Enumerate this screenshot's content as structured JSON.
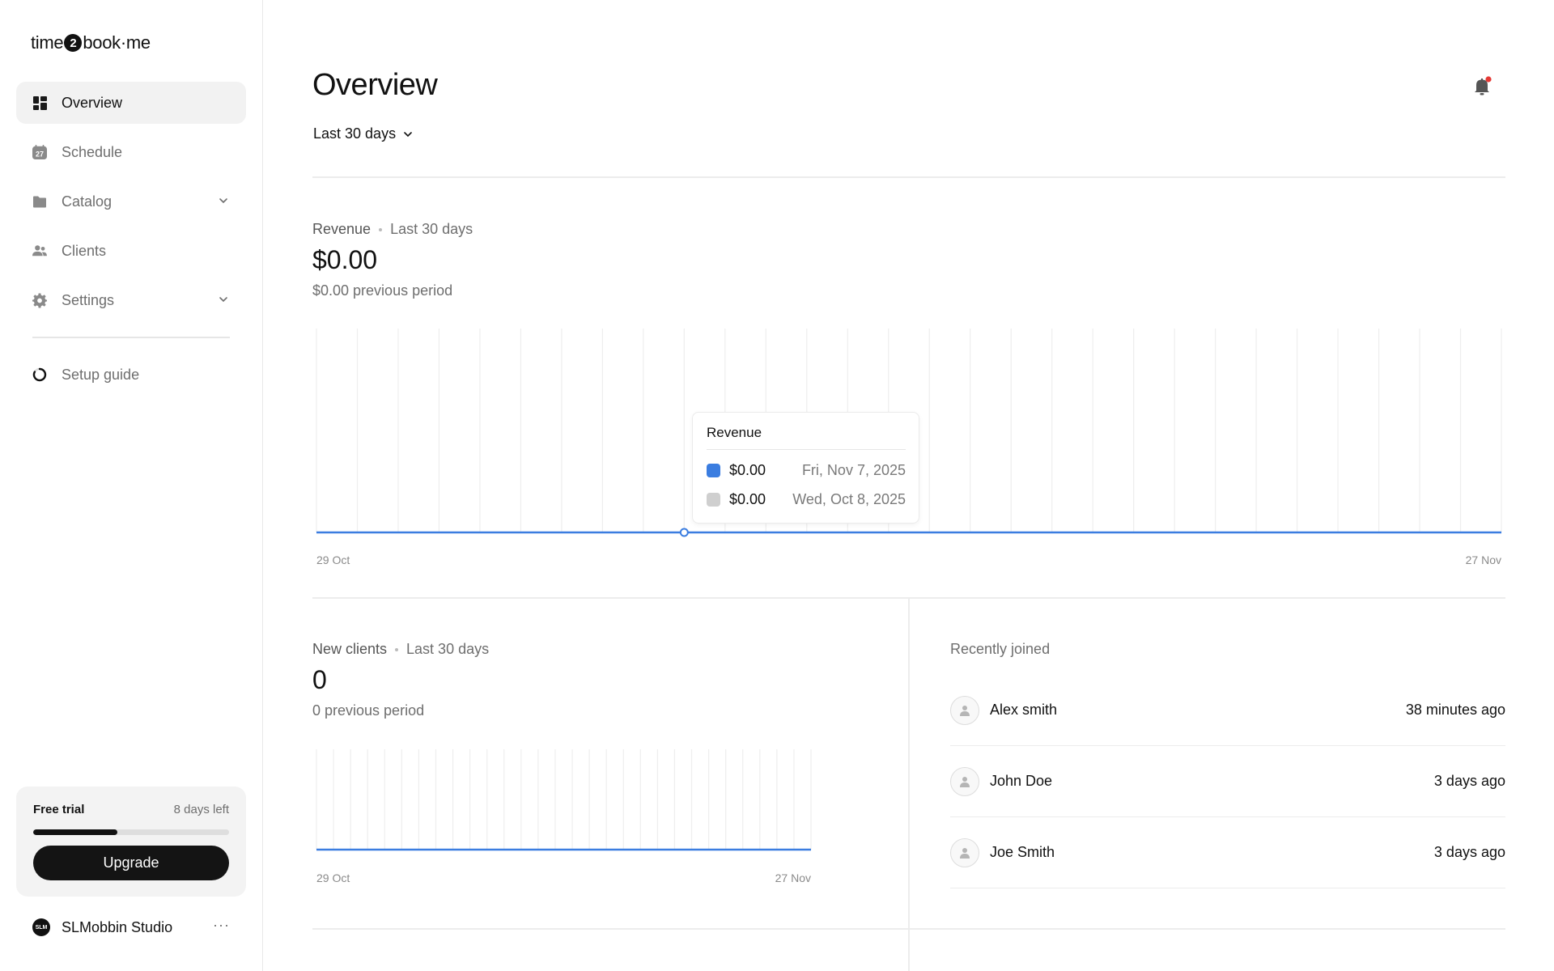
{
  "brand": {
    "logo_part1": "time",
    "logo_badge": "2",
    "logo_part2": "book·me"
  },
  "sidebar": {
    "items": [
      {
        "label": "Overview",
        "icon": "dashboard-icon",
        "active": true
      },
      {
        "label": "Schedule",
        "icon": "calendar-icon",
        "badge": "27"
      },
      {
        "label": "Catalog",
        "icon": "folder-icon",
        "expandable": true
      },
      {
        "label": "Clients",
        "icon": "users-icon"
      },
      {
        "label": "Settings",
        "icon": "gear-icon",
        "expandable": true
      }
    ],
    "setup_label": "Setup guide",
    "trial": {
      "title": "Free trial",
      "days_left": "8 days left",
      "progress": 0.43,
      "upgrade_label": "Upgrade"
    },
    "studio": {
      "avatar_text": "SLM",
      "name": "SLMobbin Studio",
      "more": "···"
    }
  },
  "header": {
    "title": "Overview",
    "range": "Last 30 days",
    "notification_dot_color": "#e53935"
  },
  "revenue": {
    "label": "Revenue",
    "range": "Last 30 days",
    "value": "$0.00",
    "previous": "$0.00 previous period",
    "x_start": "29 Oct",
    "x_end": "27 Nov",
    "tooltip": {
      "title": "Revenue",
      "rows": [
        {
          "amount": "$0.00",
          "date": "Fri, Nov 7, 2025",
          "color": "#3b7de0"
        },
        {
          "amount": "$0.00",
          "date": "Wed, Oct 8, 2025",
          "color": "#cfcfcf"
        }
      ]
    }
  },
  "new_clients": {
    "label": "New clients",
    "range": "Last 30 days",
    "value": "0",
    "previous": "0 previous period",
    "x_start": "29 Oct",
    "x_end": "27 Nov"
  },
  "recent": {
    "title": "Recently joined",
    "rows": [
      {
        "name": "Alex smith",
        "time": "38 minutes ago"
      },
      {
        "name": "John Doe",
        "time": "3 days ago"
      },
      {
        "name": "Joe Smith",
        "time": "3 days ago"
      }
    ]
  },
  "chart_data": [
    {
      "type": "line",
      "series": [
        {
          "name": "Revenue",
          "values": [
            0,
            0,
            0,
            0,
            0,
            0,
            0,
            0,
            0,
            0,
            0,
            0,
            0,
            0,
            0,
            0,
            0,
            0,
            0,
            0,
            0,
            0,
            0,
            0,
            0,
            0,
            0,
            0,
            0,
            0
          ]
        }
      ],
      "x_start": "29 Oct",
      "x_end": "27 Nov",
      "points": 30,
      "highlight_index": 9,
      "line_color": "#3b7de0",
      "grid": true
    },
    {
      "type": "line",
      "series": [
        {
          "name": "New clients",
          "values": [
            0,
            0,
            0,
            0,
            0,
            0,
            0,
            0,
            0,
            0,
            0,
            0,
            0,
            0,
            0,
            0,
            0,
            0,
            0,
            0,
            0,
            0,
            0,
            0,
            0,
            0,
            0,
            0,
            0,
            0
          ]
        }
      ],
      "x_start": "29 Oct",
      "x_end": "27 Nov",
      "points": 30,
      "line_color": "#3b7de0",
      "grid": true
    }
  ]
}
